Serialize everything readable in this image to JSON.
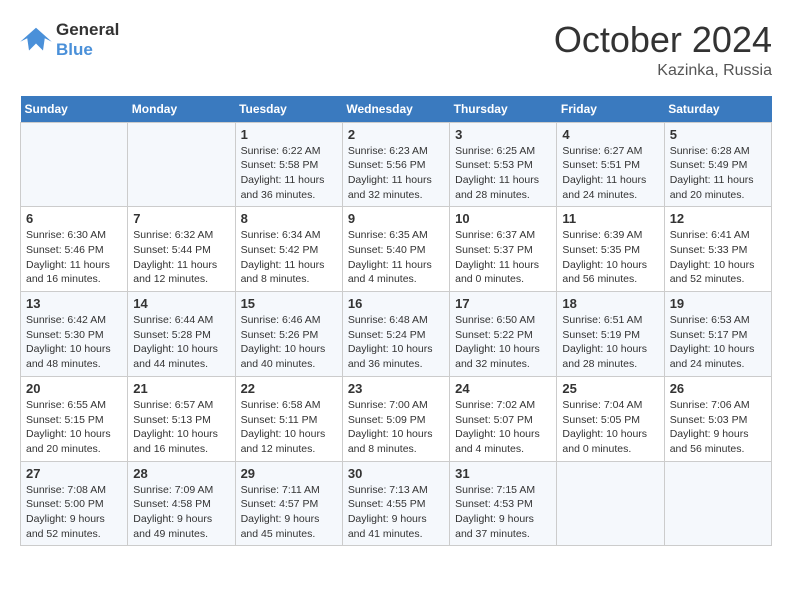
{
  "header": {
    "logo_line1": "General",
    "logo_line2": "Blue",
    "month_year": "October 2024",
    "location": "Kazinka, Russia"
  },
  "weekdays": [
    "Sunday",
    "Monday",
    "Tuesday",
    "Wednesday",
    "Thursday",
    "Friday",
    "Saturday"
  ],
  "weeks": [
    [
      {
        "day": "",
        "info": ""
      },
      {
        "day": "",
        "info": ""
      },
      {
        "day": "1",
        "info": "Sunrise: 6:22 AM\nSunset: 5:58 PM\nDaylight: 11 hours and 36 minutes."
      },
      {
        "day": "2",
        "info": "Sunrise: 6:23 AM\nSunset: 5:56 PM\nDaylight: 11 hours and 32 minutes."
      },
      {
        "day": "3",
        "info": "Sunrise: 6:25 AM\nSunset: 5:53 PM\nDaylight: 11 hours and 28 minutes."
      },
      {
        "day": "4",
        "info": "Sunrise: 6:27 AM\nSunset: 5:51 PM\nDaylight: 11 hours and 24 minutes."
      },
      {
        "day": "5",
        "info": "Sunrise: 6:28 AM\nSunset: 5:49 PM\nDaylight: 11 hours and 20 minutes."
      }
    ],
    [
      {
        "day": "6",
        "info": "Sunrise: 6:30 AM\nSunset: 5:46 PM\nDaylight: 11 hours and 16 minutes."
      },
      {
        "day": "7",
        "info": "Sunrise: 6:32 AM\nSunset: 5:44 PM\nDaylight: 11 hours and 12 minutes."
      },
      {
        "day": "8",
        "info": "Sunrise: 6:34 AM\nSunset: 5:42 PM\nDaylight: 11 hours and 8 minutes."
      },
      {
        "day": "9",
        "info": "Sunrise: 6:35 AM\nSunset: 5:40 PM\nDaylight: 11 hours and 4 minutes."
      },
      {
        "day": "10",
        "info": "Sunrise: 6:37 AM\nSunset: 5:37 PM\nDaylight: 11 hours and 0 minutes."
      },
      {
        "day": "11",
        "info": "Sunrise: 6:39 AM\nSunset: 5:35 PM\nDaylight: 10 hours and 56 minutes."
      },
      {
        "day": "12",
        "info": "Sunrise: 6:41 AM\nSunset: 5:33 PM\nDaylight: 10 hours and 52 minutes."
      }
    ],
    [
      {
        "day": "13",
        "info": "Sunrise: 6:42 AM\nSunset: 5:30 PM\nDaylight: 10 hours and 48 minutes."
      },
      {
        "day": "14",
        "info": "Sunrise: 6:44 AM\nSunset: 5:28 PM\nDaylight: 10 hours and 44 minutes."
      },
      {
        "day": "15",
        "info": "Sunrise: 6:46 AM\nSunset: 5:26 PM\nDaylight: 10 hours and 40 minutes."
      },
      {
        "day": "16",
        "info": "Sunrise: 6:48 AM\nSunset: 5:24 PM\nDaylight: 10 hours and 36 minutes."
      },
      {
        "day": "17",
        "info": "Sunrise: 6:50 AM\nSunset: 5:22 PM\nDaylight: 10 hours and 32 minutes."
      },
      {
        "day": "18",
        "info": "Sunrise: 6:51 AM\nSunset: 5:19 PM\nDaylight: 10 hours and 28 minutes."
      },
      {
        "day": "19",
        "info": "Sunrise: 6:53 AM\nSunset: 5:17 PM\nDaylight: 10 hours and 24 minutes."
      }
    ],
    [
      {
        "day": "20",
        "info": "Sunrise: 6:55 AM\nSunset: 5:15 PM\nDaylight: 10 hours and 20 minutes."
      },
      {
        "day": "21",
        "info": "Sunrise: 6:57 AM\nSunset: 5:13 PM\nDaylight: 10 hours and 16 minutes."
      },
      {
        "day": "22",
        "info": "Sunrise: 6:58 AM\nSunset: 5:11 PM\nDaylight: 10 hours and 12 minutes."
      },
      {
        "day": "23",
        "info": "Sunrise: 7:00 AM\nSunset: 5:09 PM\nDaylight: 10 hours and 8 minutes."
      },
      {
        "day": "24",
        "info": "Sunrise: 7:02 AM\nSunset: 5:07 PM\nDaylight: 10 hours and 4 minutes."
      },
      {
        "day": "25",
        "info": "Sunrise: 7:04 AM\nSunset: 5:05 PM\nDaylight: 10 hours and 0 minutes."
      },
      {
        "day": "26",
        "info": "Sunrise: 7:06 AM\nSunset: 5:03 PM\nDaylight: 9 hours and 56 minutes."
      }
    ],
    [
      {
        "day": "27",
        "info": "Sunrise: 7:08 AM\nSunset: 5:00 PM\nDaylight: 9 hours and 52 minutes."
      },
      {
        "day": "28",
        "info": "Sunrise: 7:09 AM\nSunset: 4:58 PM\nDaylight: 9 hours and 49 minutes."
      },
      {
        "day": "29",
        "info": "Sunrise: 7:11 AM\nSunset: 4:57 PM\nDaylight: 9 hours and 45 minutes."
      },
      {
        "day": "30",
        "info": "Sunrise: 7:13 AM\nSunset: 4:55 PM\nDaylight: 9 hours and 41 minutes."
      },
      {
        "day": "31",
        "info": "Sunrise: 7:15 AM\nSunset: 4:53 PM\nDaylight: 9 hours and 37 minutes."
      },
      {
        "day": "",
        "info": ""
      },
      {
        "day": "",
        "info": ""
      }
    ]
  ]
}
